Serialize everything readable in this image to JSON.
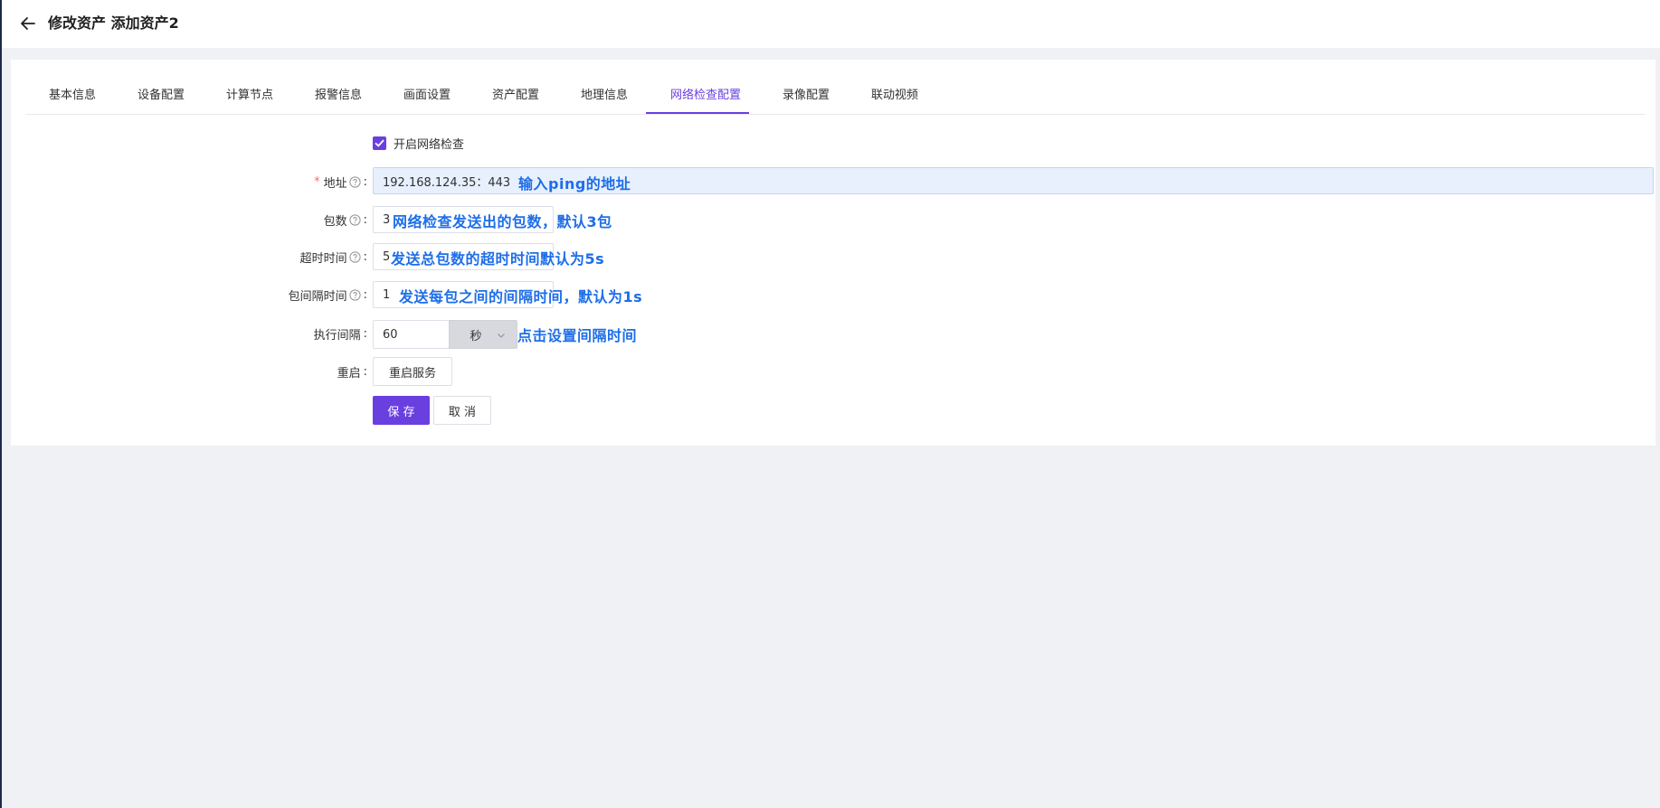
{
  "header": {
    "title": "修改资产 添加资产2",
    "back_icon": "arrow-left-icon"
  },
  "tabs": [
    {
      "label": "基本信息",
      "active": false
    },
    {
      "label": "设备配置",
      "active": false
    },
    {
      "label": "计算节点",
      "active": false
    },
    {
      "label": "报警信息",
      "active": false
    },
    {
      "label": "画面设置",
      "active": false
    },
    {
      "label": "资产配置",
      "active": false
    },
    {
      "label": "地理信息",
      "active": false
    },
    {
      "label": "网络检查配置",
      "active": true
    },
    {
      "label": "录像配置",
      "active": false
    },
    {
      "label": "联动视频",
      "active": false
    }
  ],
  "form": {
    "enable_check": {
      "label": "开启网络检查",
      "checked": true
    },
    "address": {
      "label": "地址",
      "required": true,
      "value": "192.168.124.35：443",
      "annotation": "输入ping的地址"
    },
    "packets": {
      "label": "包数",
      "value": "3",
      "annotation": "网络检查发送出的包数，默认3包"
    },
    "timeout": {
      "label": "超时时间",
      "value": "5",
      "annotation": "发送总包数的超时时间默认为5s"
    },
    "interval": {
      "label": "包间隔时间",
      "value": "1",
      "annotation": "发送每包之间的间隔时间，默认为1s"
    },
    "exec_interval": {
      "label": "执行间隔",
      "value": "60",
      "unit": "秒",
      "annotation": "点击设置间隔时间"
    },
    "restart": {
      "label": "重启",
      "button": "重启服务"
    },
    "colon": ":",
    "save_button": "保 存",
    "cancel_button": "取 消"
  },
  "colors": {
    "accent": "#6a3fe0",
    "annotation": "#1e6ee8",
    "required": "#f56c6c",
    "background": "#eff1f5"
  }
}
